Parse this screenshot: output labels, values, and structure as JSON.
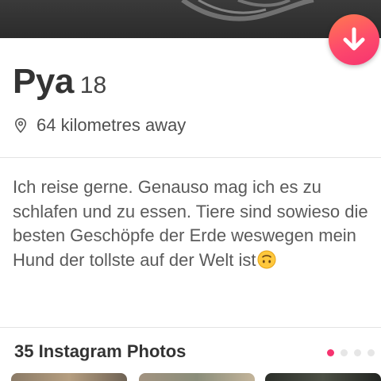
{
  "profile": {
    "name": "Pya",
    "age": "18",
    "distance": "64 kilometres away",
    "bio": "Ich reise gerne. Genauso mag ich es zu schlafen und zu essen. Tiere sind sowieso die besten Geschöpfe der Erde weswegen mein Hund der tollste auf der Welt ist",
    "bio_emoji": "upside-down-face-emoji"
  },
  "instagram": {
    "title": "35 Instagram Photos",
    "page_count": 4,
    "active_page": 1
  },
  "icons": {
    "collapse": "arrow-down-icon",
    "location": "location-pin-icon"
  },
  "colors": {
    "accent": "#f6336f",
    "accent_gradient_start": "#ff7a4f",
    "name_text": "#333333",
    "secondary_text": "#5a5a5a",
    "divider": "#e3e3e3",
    "inactive_dot": "#e6e6e6"
  }
}
